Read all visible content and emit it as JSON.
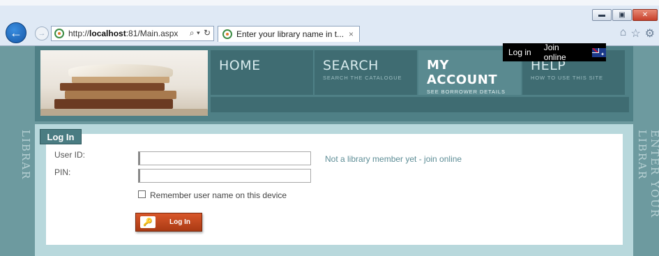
{
  "browser": {
    "url_prefix": "http://",
    "url_host": "localhost",
    "url_rest": ":81/Main.aspx",
    "tab_title": "Enter your library name in t...",
    "tab_close": "×",
    "win_minimize": "▬",
    "win_restore": "▣",
    "win_close": "✕",
    "back_icon": "back-arrow-icon",
    "forward_icon": "forward-arrow-icon",
    "addr_search_glyph": "⌕ ▾",
    "addr_refresh_glyph": "↻",
    "home_glyph": "⌂",
    "favorites_glyph": "☆",
    "settings_glyph": "⚙"
  },
  "side_banner": "ENTER YOUR LIBRAR",
  "header": {
    "top_links": {
      "login": "Log in",
      "join": "Join online"
    },
    "nav": [
      {
        "label": "HOME",
        "sub": ""
      },
      {
        "label": "SEARCH",
        "sub": "SEARCH THE CATALOGUE"
      },
      {
        "label": "MY ACCOUNT",
        "sub": "SEE BORROWER DETAILS"
      },
      {
        "label": "HELP",
        "sub": "HOW TO USE THIS SITE"
      }
    ]
  },
  "login_form": {
    "tab_label": "Log In",
    "user_id_label": "User ID:",
    "pin_label": "PIN:",
    "user_id_value": "",
    "pin_value": "",
    "join_link": "Not a library member yet - join online",
    "remember_label": "Remember user name on this device",
    "remember_checked": false,
    "button_label": "Log In"
  },
  "colors": {
    "page_bg": "#6d9a9f",
    "nav_bg": "#3f6c72",
    "nav_active_bg": "#5a8a90",
    "login_button": "#c2461c",
    "link_color": "#5d8d96"
  }
}
